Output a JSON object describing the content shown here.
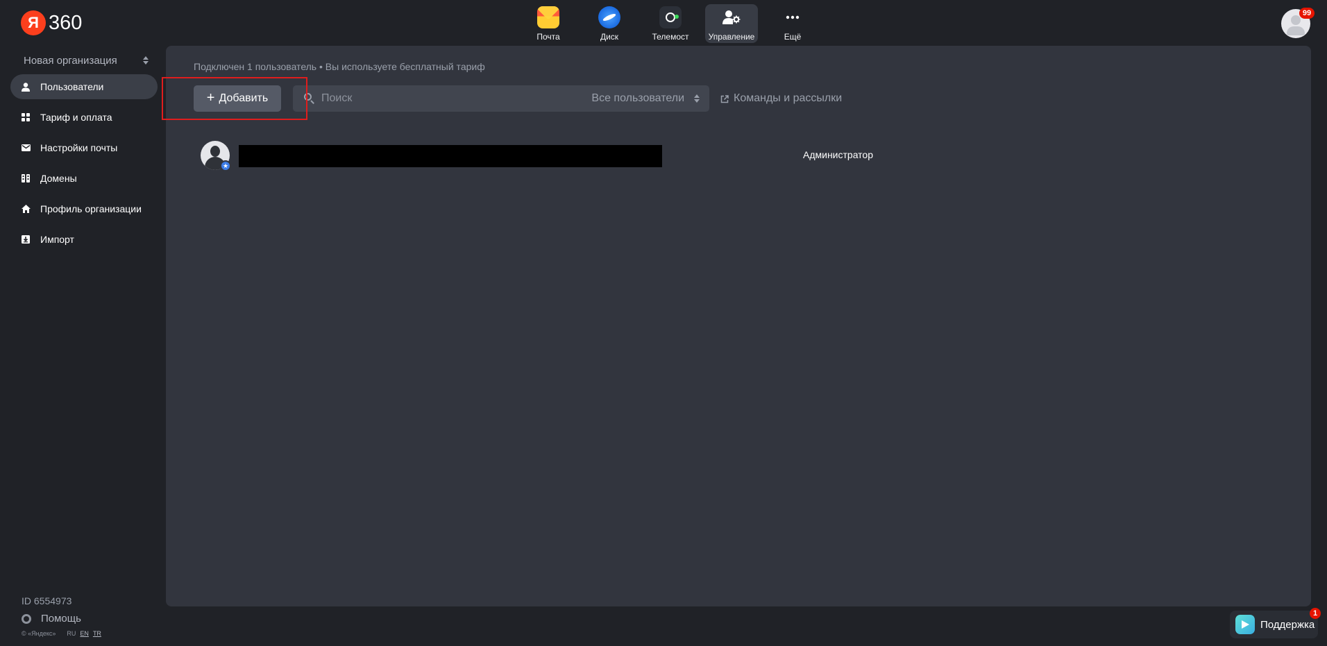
{
  "header": {
    "logo_letter": "Я",
    "logo_text": "360",
    "services": [
      {
        "label": "Почта",
        "icon": "mail-icon"
      },
      {
        "label": "Диск",
        "icon": "disk-icon"
      },
      {
        "label": "Телемост",
        "icon": "telemost-icon"
      },
      {
        "label": "Управление",
        "icon": "admin-icon",
        "active": true
      },
      {
        "label": "Ещё",
        "icon": "more-icon"
      }
    ],
    "notification_count": "99"
  },
  "sidebar": {
    "org_name": "Новая организация",
    "items": [
      {
        "label": "Пользователи",
        "icon": "user-icon",
        "active": true
      },
      {
        "label": "Тариф и оплата",
        "icon": "grid-icon"
      },
      {
        "label": "Настройки почты",
        "icon": "envelope-icon"
      },
      {
        "label": "Домены",
        "icon": "domain-icon"
      },
      {
        "label": "Профиль организации",
        "icon": "home-icon"
      },
      {
        "label": "Импорт",
        "icon": "import-icon"
      }
    ],
    "org_id": "ID 6554973",
    "help_label": "Помощь",
    "copyright": "© «Яндекс»",
    "languages": [
      {
        "code": "RU",
        "link": false
      },
      {
        "code": "EN",
        "link": true
      },
      {
        "code": "TR",
        "link": true
      }
    ]
  },
  "main": {
    "summary": "Подключен 1 пользователь • Вы используете бесплатный тариф",
    "add_button_label": "Добавить",
    "search_placeholder": "Поиск",
    "filter_label": "Все пользователи",
    "teams_link_label": "Команды и рассылки",
    "users": [
      {
        "name": "",
        "role": "Администратор",
        "is_admin": true
      }
    ]
  },
  "support": {
    "label": "Поддержка",
    "badge": "1"
  },
  "colors": {
    "page_bg": "#202227",
    "panel_bg": "#32353e",
    "accent_red": "#fc3f1d",
    "highlight": "#e01d1d",
    "badge_red": "#e61400",
    "admin_star": "#3d7de8"
  }
}
